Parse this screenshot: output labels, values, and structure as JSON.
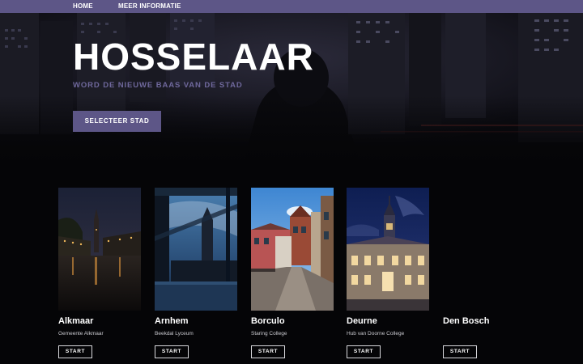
{
  "nav": {
    "home_label": "HOME",
    "info_label": "MEER INFORMATIE",
    "bar_color": "#5d5687"
  },
  "hero": {
    "title": "HOSSELAAR",
    "subtitle": "WORD DE NIEUWE BAAS VAN DE STAD",
    "button_label": "SELECTEER STAD",
    "accent_color": "#6f689c"
  },
  "cities": [
    {
      "name": "Alkmaar",
      "school": "Gemeente Alkmaar",
      "button_label": "START",
      "image": "canal-at-night-photo"
    },
    {
      "name": "Arnhem",
      "school": "Beekdal Lyceum",
      "button_label": "START",
      "image": "tower-through-window-photo"
    },
    {
      "name": "Borculo",
      "school": "Staring College",
      "button_label": "START",
      "image": "brick-street-photo"
    },
    {
      "name": "Deurne",
      "school": "Hub van Doorne College",
      "button_label": "START",
      "image": "town-hall-at-night-photo"
    },
    {
      "name": "Den Bosch",
      "school": "",
      "button_label": "START",
      "image": ""
    }
  ]
}
